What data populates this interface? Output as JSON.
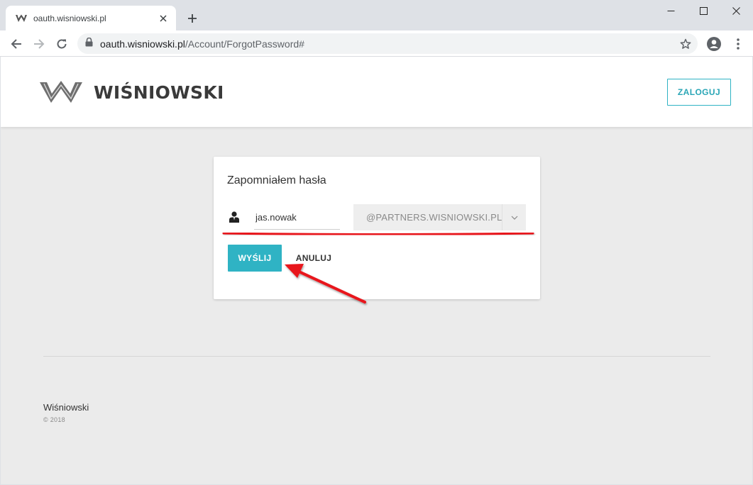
{
  "browser": {
    "tab_title": "oauth.wisniowski.pl",
    "url_host": "oauth.wisniowski.pl",
    "url_path": "/Account/ForgotPassword#",
    "icons": [
      "wisniowski-favicon",
      "close-icon",
      "plus-icon",
      "minimize-icon",
      "maximize-icon",
      "close-window-icon",
      "back-arrow-icon",
      "forward-arrow-icon",
      "reload-icon",
      "lock-icon",
      "star-icon",
      "profile-icon",
      "kebab-menu-icon"
    ]
  },
  "header": {
    "brand": "WIŚNIOWSKI",
    "login_label": "ZALOGUJ",
    "accent_color": "#2fb3c4"
  },
  "form": {
    "title": "Zapomniałem hasła",
    "username_value": "jas.nowak",
    "domain_value": "@PARTNERS.WISNIOWSKI.PL",
    "send_label": "WYŚLIJ",
    "cancel_label": "ANULUJ"
  },
  "annotation": {
    "color": "#e8141a",
    "items": [
      "red underline under login row",
      "red arrow pointing at send button"
    ]
  },
  "footer": {
    "brand": "Wiśniowski",
    "copyright": "© 2018"
  }
}
